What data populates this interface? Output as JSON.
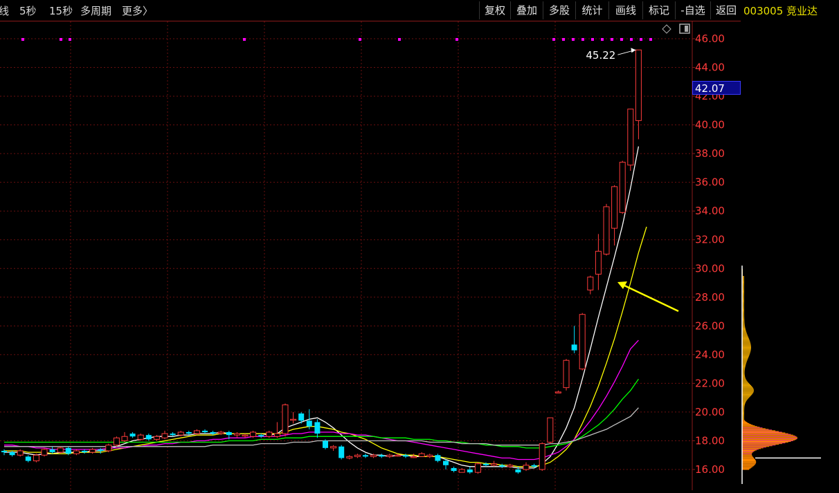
{
  "toolbar": {
    "left_items": [
      "线",
      "5秒",
      "15秒",
      "多周期",
      "更多〉"
    ],
    "right_buttons": [
      "复权",
      "叠加",
      "多股",
      "统计",
      "画线",
      "标记",
      "-自选",
      "返回"
    ]
  },
  "stock": {
    "code_name": "003005 竞业达"
  },
  "price_axis": {
    "ticks": [
      "46.00",
      "44.00",
      "42.00",
      "40.00",
      "38.00",
      "36.00",
      "34.00",
      "32.00",
      "30.00",
      "28.00",
      "26.00",
      "24.00",
      "22.00",
      "20.00",
      "18.00",
      "16.00"
    ]
  },
  "last_price": "42.07",
  "high_label": "45.22",
  "colors": {
    "up": "#ff3b3b",
    "down": "#00e0ff",
    "ma5": "#ffffff",
    "ma10": "#ffff00",
    "ma20": "#ff00ff",
    "ma30": "#00ff00",
    "ma60": "#c0c0c0",
    "grid": "#6b0f0f"
  },
  "chart_data": {
    "type": "candlestick",
    "y_range": [
      15.6,
      46.8
    ],
    "candles": [
      [
        17.3,
        17.2,
        17.4,
        17.0
      ],
      [
        17.2,
        17.0,
        17.3,
        16.9
      ],
      [
        17.0,
        17.3,
        17.4,
        16.9
      ],
      [
        16.9,
        16.6,
        17.0,
        16.5
      ],
      [
        16.6,
        17.0,
        17.1,
        16.5
      ],
      [
        17.0,
        17.4,
        17.5,
        16.9
      ],
      [
        17.4,
        17.2,
        17.6,
        17.1
      ],
      [
        17.2,
        17.5,
        17.6,
        17.1
      ],
      [
        17.5,
        17.1,
        17.6,
        17.0
      ],
      [
        17.1,
        17.3,
        17.4,
        17.0
      ],
      [
        17.3,
        17.2,
        17.4,
        17.1
      ],
      [
        17.2,
        17.4,
        17.5,
        17.1
      ],
      [
        17.4,
        17.3,
        17.5,
        17.1
      ],
      [
        17.3,
        17.7,
        17.8,
        17.2
      ],
      [
        17.7,
        18.2,
        18.3,
        17.6
      ],
      [
        18.0,
        18.3,
        18.6,
        17.9
      ],
      [
        18.5,
        18.3,
        18.6,
        18.2
      ],
      [
        18.1,
        18.4,
        18.5,
        18.0
      ],
      [
        18.4,
        18.1,
        18.5,
        18.0
      ],
      [
        18.1,
        18.3,
        18.4,
        18.0
      ],
      [
        18.2,
        18.5,
        18.7,
        18.1
      ],
      [
        18.5,
        18.4,
        18.6,
        18.3
      ],
      [
        18.4,
        18.6,
        18.7,
        18.3
      ],
      [
        18.6,
        18.5,
        18.7,
        18.4
      ],
      [
        18.5,
        18.7,
        18.8,
        18.4
      ],
      [
        18.7,
        18.6,
        18.8,
        18.5
      ],
      [
        18.6,
        18.5,
        18.7,
        18.4
      ],
      [
        18.5,
        18.6,
        18.7,
        18.4
      ],
      [
        18.6,
        18.4,
        18.7,
        18.1
      ],
      [
        18.4,
        18.5,
        18.6,
        18.2
      ],
      [
        18.4,
        18.4,
        18.5,
        18.2
      ],
      [
        18.3,
        18.6,
        18.7,
        18.2
      ],
      [
        18.4,
        18.3,
        18.5,
        18.2
      ],
      [
        18.3,
        18.6,
        18.7,
        18.2
      ],
      [
        18.3,
        18.5,
        19.3,
        18.2
      ],
      [
        18.5,
        20.5,
        20.6,
        18.3
      ],
      [
        19.5,
        19.5,
        20.0,
        19.2
      ],
      [
        19.9,
        19.4,
        20.0,
        19.2
      ],
      [
        19.4,
        19.0,
        20.2,
        18.8
      ],
      [
        19.3,
        18.5,
        19.5,
        18.2
      ],
      [
        18.0,
        17.5,
        18.1,
        17.4
      ],
      [
        17.5,
        17.6,
        17.7,
        17.3
      ],
      [
        17.6,
        16.8,
        17.7,
        16.7
      ],
      [
        16.8,
        16.9,
        17.0,
        16.7
      ],
      [
        16.9,
        17.0,
        17.1,
        16.8
      ],
      [
        17.0,
        16.9,
        17.1,
        16.8
      ],
      [
        16.9,
        17.0,
        17.1,
        16.8
      ],
      [
        17.0,
        16.9,
        17.1,
        16.8
      ],
      [
        16.9,
        17.0,
        17.1,
        16.8
      ],
      [
        17.0,
        17.0,
        17.1,
        16.9
      ],
      [
        17.0,
        16.9,
        17.1,
        16.8
      ],
      [
        16.9,
        16.9,
        17.1,
        16.8
      ],
      [
        16.9,
        17.1,
        17.2,
        16.9
      ],
      [
        16.9,
        17.0,
        17.1,
        16.8
      ],
      [
        17.0,
        16.6,
        17.1,
        16.5
      ],
      [
        16.6,
        16.3,
        16.7,
        16.0
      ],
      [
        16.1,
        15.9,
        16.2,
        15.8
      ],
      [
        15.8,
        16.0,
        16.1,
        15.8
      ],
      [
        16.0,
        15.8,
        16.2,
        15.7
      ],
      [
        15.8,
        16.4,
        16.5,
        15.7
      ],
      [
        16.4,
        16.3,
        16.5,
        16.2
      ],
      [
        16.3,
        16.4,
        16.6,
        16.2
      ],
      [
        16.3,
        16.2,
        16.4,
        16.1
      ],
      [
        16.2,
        16.3,
        16.4,
        16.1
      ],
      [
        16.0,
        15.8,
        16.2,
        15.7
      ],
      [
        16.0,
        16.3,
        16.5,
        15.9
      ],
      [
        16.3,
        16.2,
        16.4,
        16.1
      ],
      [
        16.0,
        17.8,
        17.9,
        15.9
      ],
      [
        17.9,
        19.6,
        19.6,
        17.8
      ],
      [
        21.4,
        21.4,
        21.5,
        21.4
      ],
      [
        21.7,
        23.6,
        23.7,
        21.5
      ],
      [
        24.7,
        24.3,
        26.0,
        24.1
      ],
      [
        23.0,
        26.8,
        26.9,
        22.9
      ],
      [
        28.5,
        29.4,
        29.5,
        28.2
      ],
      [
        29.6,
        31.2,
        32.4,
        28.5
      ],
      [
        31.0,
        34.3,
        34.5,
        30.9
      ],
      [
        32.8,
        35.7,
        35.8,
        31.6
      ],
      [
        33.9,
        37.4,
        37.5,
        33.8
      ],
      [
        37.2,
        41.1,
        41.1,
        36.8
      ],
      [
        40.3,
        45.22,
        45.22,
        39.0
      ]
    ],
    "series": [
      {
        "values": [
          17.2,
          17.2,
          17.2,
          17.1,
          17.0,
          17.1,
          17.1,
          17.2,
          17.2,
          17.2,
          17.2,
          17.3,
          17.3,
          17.4,
          17.6,
          17.8,
          18.0,
          18.1,
          18.2,
          18.3,
          18.3,
          18.3,
          18.4,
          18.4,
          18.5,
          18.5,
          18.5,
          18.6,
          18.5,
          18.5,
          18.5,
          18.5,
          18.5,
          18.4,
          18.5,
          18.9,
          19.1,
          19.3,
          19.5,
          19.6,
          19.3,
          18.9,
          18.4,
          17.9,
          17.5,
          17.2,
          17.0,
          17.0,
          16.9,
          17.0,
          17.0,
          16.9,
          16.9,
          16.9,
          16.9,
          16.7,
          16.5,
          16.3,
          16.2,
          16.2,
          16.2,
          16.2,
          16.2,
          16.2,
          16.1,
          16.1,
          16.1,
          16.4,
          16.9,
          17.8,
          18.9,
          20.3,
          22.3,
          24.4,
          26.6,
          28.7,
          30.8,
          33.0,
          35.6,
          38.5
        ]
      },
      {
        "values": [
          17.3,
          17.3,
          17.3,
          17.2,
          17.2,
          17.2,
          17.1,
          17.1,
          17.1,
          17.2,
          17.2,
          17.2,
          17.2,
          17.3,
          17.4,
          17.5,
          17.6,
          17.7,
          17.8,
          17.9,
          18.0,
          18.1,
          18.2,
          18.3,
          18.4,
          18.4,
          18.4,
          18.5,
          18.5,
          18.5,
          18.5,
          18.5,
          18.5,
          18.5,
          18.5,
          18.6,
          18.8,
          18.9,
          19.0,
          19.0,
          18.9,
          18.8,
          18.6,
          18.5,
          18.3,
          18.1,
          17.8,
          17.5,
          17.3,
          17.1,
          17.0,
          17.0,
          16.9,
          16.9,
          16.9,
          16.8,
          16.7,
          16.6,
          16.5,
          16.5,
          16.4,
          16.4,
          16.3,
          16.3,
          16.2,
          16.2,
          16.2,
          16.3,
          16.5,
          16.9,
          17.4,
          18.1,
          19.2,
          20.4,
          21.8,
          23.4,
          25.1,
          27.0,
          29.0,
          31.1,
          32.9
        ]
      },
      {
        "values": [
          17.7,
          17.7,
          17.6,
          17.6,
          17.5,
          17.5,
          17.4,
          17.4,
          17.4,
          17.4,
          17.4,
          17.4,
          17.4,
          17.5,
          17.5,
          17.5,
          17.6,
          17.6,
          17.7,
          17.7,
          17.8,
          17.8,
          17.9,
          17.9,
          18.0,
          18.0,
          18.1,
          18.1,
          18.2,
          18.2,
          18.2,
          18.3,
          18.3,
          18.3,
          18.3,
          18.4,
          18.5,
          18.5,
          18.6,
          18.6,
          18.6,
          18.6,
          18.5,
          18.5,
          18.4,
          18.4,
          18.3,
          18.2,
          18.1,
          18.0,
          18.0,
          17.9,
          17.8,
          17.7,
          17.6,
          17.5,
          17.4,
          17.3,
          17.2,
          17.1,
          17.0,
          16.9,
          16.8,
          16.8,
          16.7,
          16.7,
          16.7,
          16.8,
          17.0,
          17.2,
          17.6,
          18.1,
          18.7,
          19.4,
          20.2,
          21.1,
          22.1,
          23.2,
          24.4,
          25.0
        ]
      },
      {
        "values": [
          17.9,
          17.9,
          17.9,
          17.9,
          17.9,
          17.9,
          17.9,
          17.9,
          17.9,
          17.9,
          17.9,
          17.9,
          17.9,
          17.9,
          17.9,
          17.9,
          17.9,
          17.9,
          17.9,
          17.9,
          17.9,
          17.9,
          17.9,
          17.9,
          17.9,
          17.9,
          17.9,
          17.9,
          18.0,
          18.0,
          18.0,
          18.0,
          18.1,
          18.1,
          18.1,
          18.2,
          18.2,
          18.2,
          18.3,
          18.3,
          18.3,
          18.3,
          18.3,
          18.3,
          18.3,
          18.3,
          18.3,
          18.2,
          18.2,
          18.2,
          18.2,
          18.1,
          18.1,
          18.1,
          18.0,
          18.0,
          17.9,
          17.9,
          17.8,
          17.8,
          17.7,
          17.7,
          17.6,
          17.6,
          17.6,
          17.5,
          17.5,
          17.5,
          17.6,
          17.7,
          17.8,
          18.0,
          18.3,
          18.7,
          19.1,
          19.6,
          20.2,
          20.9,
          21.5,
          22.3
        ]
      },
      {
        "values": [
          17.6,
          17.6,
          17.6,
          17.6,
          17.6,
          17.6,
          17.6,
          17.6,
          17.6,
          17.6,
          17.6,
          17.6,
          17.6,
          17.6,
          17.6,
          17.6,
          17.6,
          17.6,
          17.6,
          17.6,
          17.6,
          17.6,
          17.6,
          17.6,
          17.6,
          17.6,
          17.7,
          17.7,
          17.7,
          17.7,
          17.7,
          17.7,
          17.8,
          17.8,
          17.8,
          17.8,
          17.9,
          17.9,
          17.9,
          18.0,
          18.0,
          18.0,
          18.0,
          18.0,
          18.0,
          18.0,
          18.0,
          18.0,
          18.0,
          18.0,
          18.0,
          18.0,
          18.0,
          17.9,
          17.9,
          17.9,
          17.9,
          17.8,
          17.8,
          17.8,
          17.8,
          17.7,
          17.7,
          17.7,
          17.7,
          17.7,
          17.7,
          17.7,
          17.8,
          17.8,
          17.9,
          18.0,
          18.2,
          18.4,
          18.6,
          18.8,
          19.1,
          19.4,
          19.7,
          20.3
        ]
      }
    ]
  }
}
